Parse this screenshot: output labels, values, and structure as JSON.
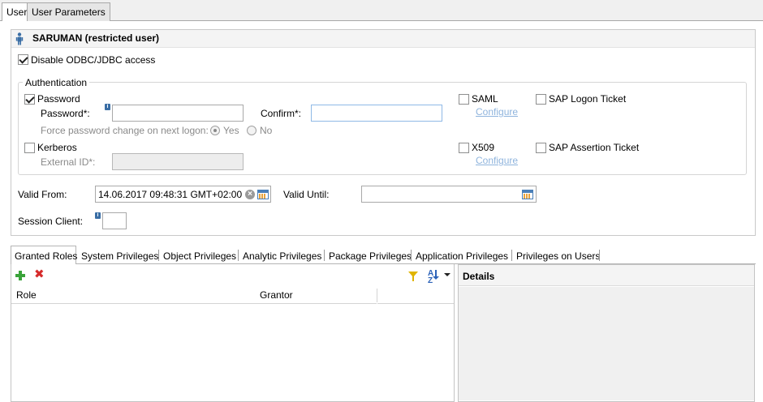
{
  "top_tabs": [
    {
      "label": "User",
      "active": true
    },
    {
      "label": "User Parameters",
      "active": false
    }
  ],
  "user": {
    "title": "SARUMAN (restricted user)",
    "disable_odbc": {
      "label": "Disable ODBC/JDBC access",
      "checked": true
    }
  },
  "authentication": {
    "legend": "Authentication",
    "password": {
      "checkbox_label": "Password",
      "checked": true,
      "password_label": "Password*:",
      "password_value": "",
      "confirm_label": "Confirm*:",
      "confirm_value": "",
      "force_change_label": "Force password change on next logon:",
      "force_yes_label": "Yes",
      "force_no_label": "No",
      "force_selected": "Yes"
    },
    "kerberos": {
      "checkbox_label": "Kerberos",
      "checked": false,
      "external_id_label": "External ID*:",
      "external_id_value": ""
    },
    "saml": {
      "label": "SAML",
      "checked": false,
      "configure_label": "Configure"
    },
    "x509": {
      "label": "X509",
      "checked": false,
      "configure_label": "Configure"
    },
    "sap_logon_ticket": {
      "label": "SAP Logon Ticket",
      "checked": false
    },
    "sap_assertion_ticket": {
      "label": "SAP Assertion Ticket",
      "checked": false
    }
  },
  "validity": {
    "valid_from_label": "Valid From:",
    "valid_from_value": "14.06.2017 09:48:31 GMT+02:00",
    "valid_until_label": "Valid Until:",
    "valid_until_value": ""
  },
  "session_client": {
    "label": "Session Client:",
    "value": ""
  },
  "bottom_tabs": [
    {
      "label": "Granted Roles",
      "active": true
    },
    {
      "label": "System Privileges",
      "active": false
    },
    {
      "label": "Object Privileges",
      "active": false
    },
    {
      "label": "Analytic Privileges",
      "active": false
    },
    {
      "label": "Package Privileges",
      "active": false
    },
    {
      "label": "Application Privileges",
      "active": false
    },
    {
      "label": "Privileges on Users",
      "active": false
    }
  ],
  "roles_table": {
    "columns": [
      "Role",
      "Grantor"
    ],
    "rows": []
  },
  "details": {
    "title": "Details"
  },
  "colors": {
    "link": "#8fb4dd",
    "add_icon": "#3aa33a",
    "delete_icon": "#d62b2b",
    "filter_icon": "#e0b400",
    "accent_blue": "#2c62b8"
  },
  "icons": {
    "person": "person-icon",
    "info": "info-icon",
    "calendar": "calendar-icon",
    "clear": "clear-icon",
    "add": "add-icon",
    "delete": "delete-icon",
    "filter": "filter-icon",
    "sort": "sort-icon",
    "menu": "chevron-down-icon"
  }
}
